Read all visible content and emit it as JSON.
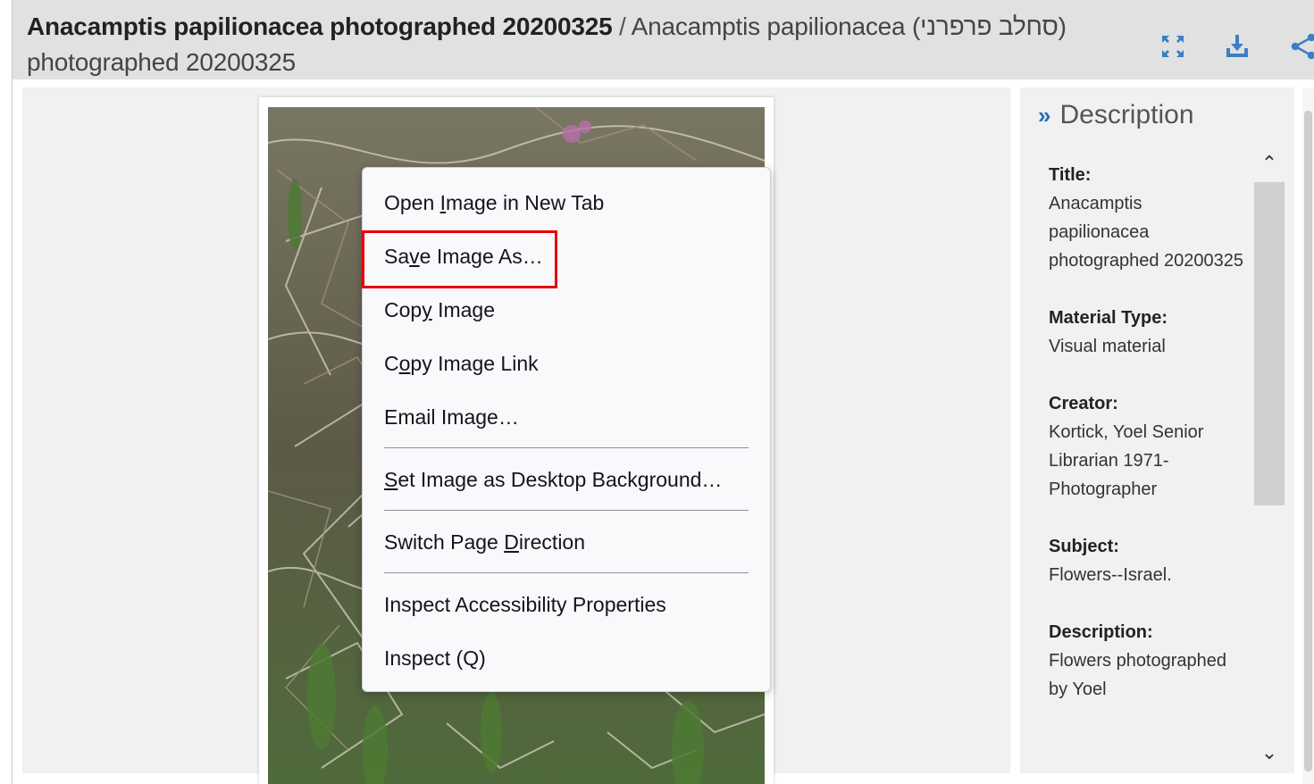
{
  "header": {
    "title_main": "Anacamptis papilionacea photographed 20200325",
    "title_separator": " / ",
    "title_alt": "Anacamptis papilionacea (סחלב פרפרני) photographed 20200325",
    "icons": [
      "expand-icon",
      "download-icon",
      "share-icon"
    ]
  },
  "context_menu": {
    "items": [
      {
        "label": "Open Image in New Tab",
        "accesskey": "I"
      },
      {
        "label": "Save Image As…",
        "accesskey": "v"
      },
      {
        "label": "Copy Image",
        "accesskey": "y"
      },
      {
        "label": "Copy Image Link",
        "accesskey": "o"
      },
      {
        "label": "Email Image…",
        "accesskey": ""
      },
      {
        "label": "Set Image as Desktop Background…",
        "accesskey": "S"
      },
      {
        "label": "Switch Page Direction",
        "accesskey": "D"
      },
      {
        "label": "Inspect Accessibility Properties",
        "accesskey": ""
      },
      {
        "label": "Inspect (Q)",
        "accesskey": ""
      }
    ],
    "highlighted_item": "Save Image As…",
    "highlight_color": "#e30000"
  },
  "description_panel": {
    "heading": "Description",
    "fields": [
      {
        "label": "Title:",
        "value": "Anacamptis papilionacea photographed 20200325"
      },
      {
        "label": "Material Type:",
        "value": "Visual material"
      },
      {
        "label": "Creator:",
        "value": "Kortick, Yoel Senior Librarian 1971- Photographer"
      },
      {
        "label": "Subject:",
        "value": "Flowers--Israel."
      },
      {
        "label": "Description:",
        "value": "Flowers photographed by Yoel"
      }
    ]
  },
  "colors": {
    "accent": "#2c6fb3",
    "header_bg": "#e1e1e1",
    "panel_bg": "#f1f1f1"
  }
}
